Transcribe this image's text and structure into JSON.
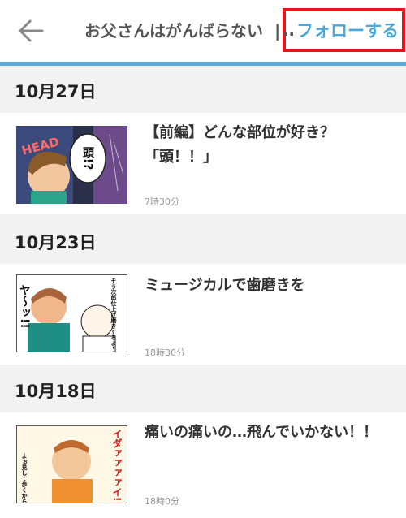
{
  "header": {
    "back_icon": "back-arrow-icon",
    "blog_title": "お父さんはがんばらない",
    "separator": "|",
    "ellipsis": "..",
    "follow_label": "フォローする"
  },
  "colors": {
    "accent": "#4aa8d8",
    "header_line": "#5aa9d6",
    "highlight": "#e8141c"
  },
  "sections": [
    {
      "date": "10月27日",
      "posts": [
        {
          "title_line1": "【前編】どんな部位が好き？",
          "title_line2": "「頭！！」",
          "time": "7時30分",
          "thumb_text": {
            "head": "HEAD",
            "bubble": "頭!?"
          }
        }
      ]
    },
    {
      "date": "10月23日",
      "posts": [
        {
          "title_line1": "ミュージカルで歯磨きを",
          "title_line2": "",
          "time": "18時30分",
          "thumb_text": {
            "shout": "ヤ〜ッ!!",
            "bubble": "そう次郎仕上げ磨きするよ〜"
          }
        }
      ]
    },
    {
      "date": "10月18日",
      "posts": [
        {
          "title_line1": "痛いの痛いの…飛んでいかない！！",
          "title_line2": "",
          "time": "18時0分",
          "thumb_text": {
            "shout": "イダァァァァイ!!",
            "bubble": "よぉ見して歩くから…"
          }
        }
      ]
    }
  ]
}
